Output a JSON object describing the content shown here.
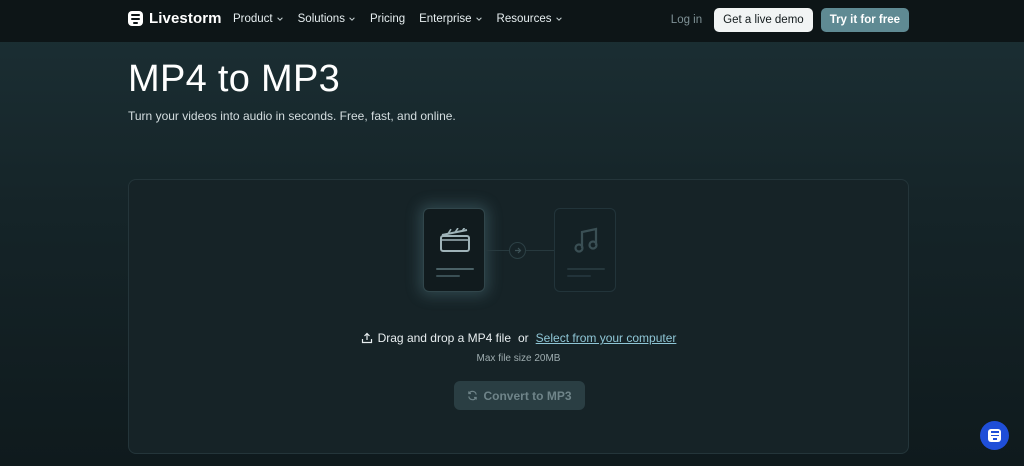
{
  "nav": {
    "brand": "Livestorm",
    "menu": [
      {
        "label": "Product",
        "has_dropdown": true
      },
      {
        "label": "Solutions",
        "has_dropdown": true
      },
      {
        "label": "Pricing",
        "has_dropdown": false
      },
      {
        "label": "Enterprise",
        "has_dropdown": true
      },
      {
        "label": "Resources",
        "has_dropdown": true
      }
    ],
    "login": "Log in",
    "demo_button": "Get a live demo",
    "try_button": "Try it for free"
  },
  "hero": {
    "title": "MP4 to MP3",
    "subtitle": "Turn your videos into audio in seconds. Free, fast, and online."
  },
  "upload": {
    "drag_text": "Drag and drop a MP4 file",
    "or_text": "or",
    "select_link": "Select from your computer",
    "max_size": "Max file size 20MB",
    "convert_button": "Convert to MP3"
  },
  "icons": {
    "brand": "livestorm-logo-icon",
    "video_file": "video-clapperboard-icon",
    "audio_file": "music-note-icon",
    "upload": "upload-icon",
    "convert": "refresh-icon",
    "chat": "chat-widget-icon"
  },
  "colors": {
    "nav_bg": "#0d1517",
    "primary_button": "#5f8a93",
    "link": "#8fc6d6",
    "chat_widget": "#1f4ed8"
  }
}
